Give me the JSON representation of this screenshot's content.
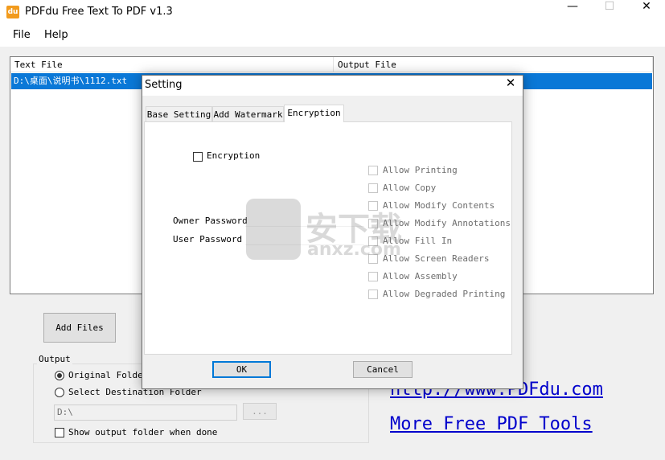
{
  "app": {
    "title": "PDFdu Free Text To PDF  v1.3",
    "icon_text": "du",
    "minimize": "—",
    "maximize": "☐",
    "close": "✕"
  },
  "menu": [
    "File",
    "Help"
  ],
  "filelist": {
    "columns": [
      "Text File",
      "Output File"
    ],
    "rows": [
      {
        "text_file": "D:\\桌面\\说明书\\1112.txt",
        "output_file": ""
      }
    ]
  },
  "add_files_label": "Add Files",
  "output": {
    "legend": "Output",
    "original_folder": "Original Folder",
    "select_destination": "Select Destination Folder",
    "folder_value": "D:\\",
    "browse_label": "...",
    "show_folder_label": "Show output folder when done"
  },
  "links": {
    "site": "http://www.PDFdu.com",
    "more_tools": "More Free PDF Tools"
  },
  "dialog": {
    "title": "Setting",
    "close": "✕",
    "tabs": [
      "Base Setting",
      "Add Watermark",
      "Encryption"
    ],
    "active_tab": "Encryption",
    "encryption_label": "Encryption",
    "owner_password_label": "Owner Password",
    "user_password_label": "User Password",
    "permissions": [
      "Allow Printing",
      "Allow Copy",
      "Allow Modify Contents",
      "Allow Modify Annotations",
      "Allow Fill In",
      "Allow Screen Readers",
      "Allow Assembly",
      "Allow Degraded Printing"
    ],
    "ok_label": "OK",
    "cancel_label": "Cancel"
  },
  "watermark": {
    "text": "安下载",
    "url": "anxz.com"
  },
  "colors": {
    "selection": "#0a78d7",
    "link": "#0000cc",
    "icon": "#f29b1d"
  }
}
